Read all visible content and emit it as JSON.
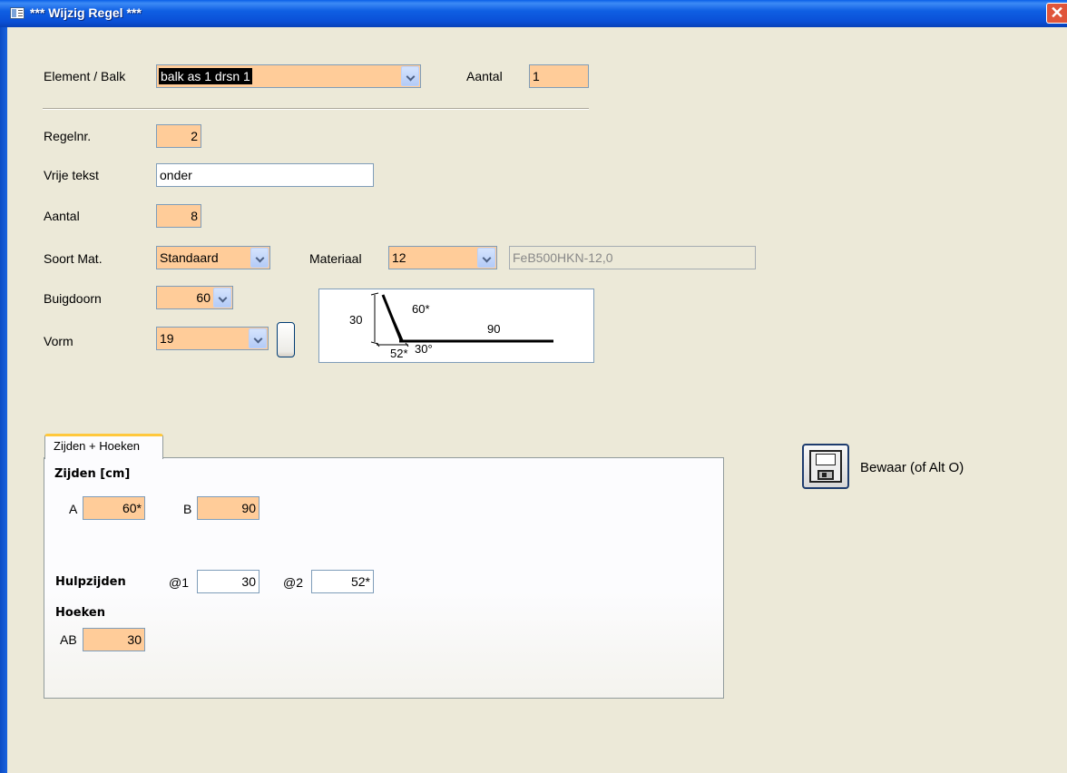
{
  "window": {
    "title": "*** Wijzig Regel ***",
    "close_glyph": "✕"
  },
  "header": {
    "element_label": "Element / Balk",
    "element_value": "balk as 1  drsn 1",
    "aantal_label": "Aantal",
    "aantal_value": "1"
  },
  "form": {
    "regelnr_label": "Regelnr.",
    "regelnr_value": "2",
    "vrije_tekst_label": "Vrije tekst",
    "vrije_tekst_value": "onder",
    "aantal_label": "Aantal",
    "aantal_value": "8",
    "soort_mat_label": "Soort Mat.",
    "soort_mat_value": "Standaard",
    "materiaal_label": "Materiaal",
    "materiaal_value": "12",
    "materiaal_desc": "FeB500HKN-12,0",
    "buigdoorn_label": "Buigdoorn",
    "buigdoorn_value": "60",
    "vorm_label": "Vorm",
    "vorm_value": "19"
  },
  "shape": {
    "height_label": "30",
    "side_a_label": "60*",
    "side_b_label": "90",
    "bottom_label": "52*",
    "angle_label": "30°"
  },
  "tabs": {
    "active_tab": "Zijden + Hoeken"
  },
  "zijden": {
    "heading": "Zijden [cm]",
    "a_label": "A",
    "a_value": "60*",
    "b_label": "B",
    "b_value": "90"
  },
  "hulpzijden": {
    "heading": "Hulpzijden",
    "h1_label": "@1",
    "h1_value": "30",
    "h2_label": "@2",
    "h2_value": "52*"
  },
  "hoeken": {
    "heading": "Hoeken",
    "ab_label": "AB",
    "ab_value": "30"
  },
  "save": {
    "label": "Bewaar (of Alt O)",
    "icon": "floppy-disk-icon"
  },
  "colors": {
    "field_bg": "#FFCC99",
    "form_bg": "#ECE9D8",
    "titlebar": "#0A4FD6"
  }
}
